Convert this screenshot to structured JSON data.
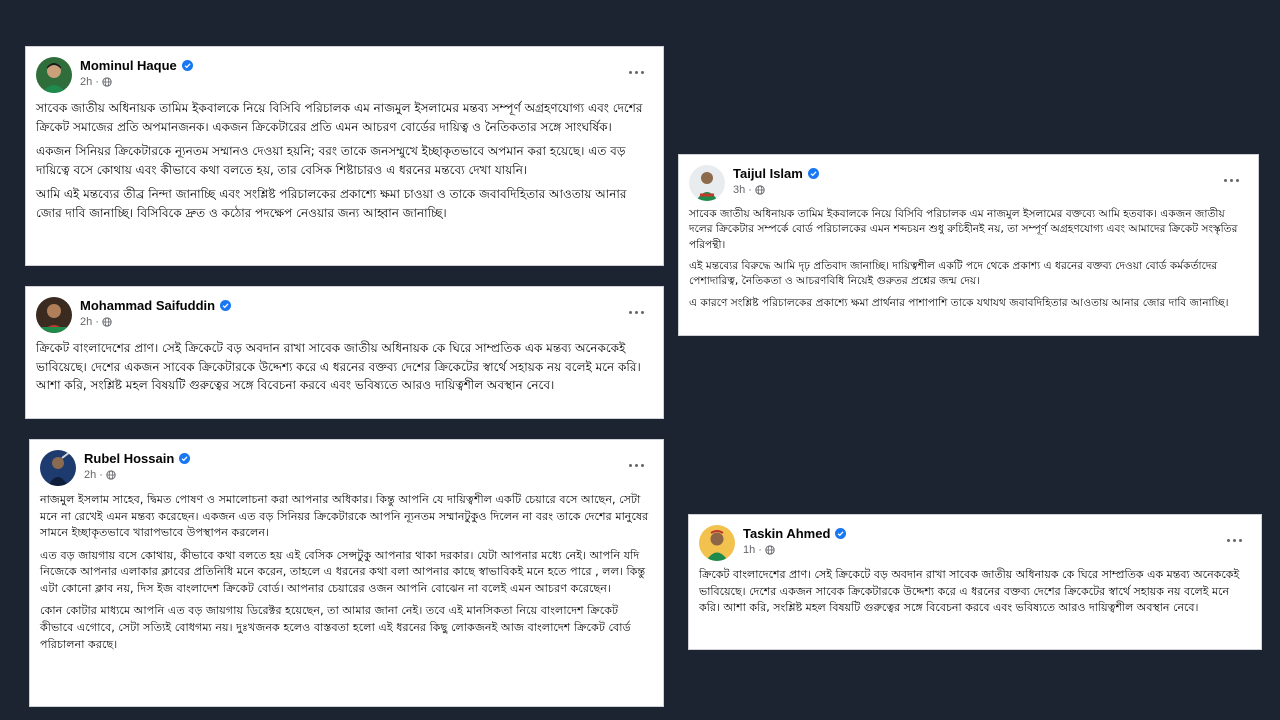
{
  "colors": {
    "background": "#1b2430",
    "verified": "#1877f2",
    "meta": "#65676b"
  },
  "posts": {
    "mominul": {
      "name": "Mominul Haque",
      "time": "2h",
      "paragraphs": [
        "সাবেক জাতীয় অধিনায়ক তামিম ইকবালকে নিয়ে বিসিবি পরিচালক এম নাজমুল ইসলামের মন্তব্য সম্পূর্ণ অগ্রহণযোগ্য এবং দেশের ক্রিকেট সমাজের প্রতি অপমানজনক। একজন ক্রিকেটারের প্রতি এমন আচরণ বোর্ডের দায়িত্ব ও নৈতিকতার সঙ্গে সাংঘর্ষিক।",
        "একজন সিনিয়র ক্রিকেটারকে ন্যূনতম সম্মানও দেওয়া হয়নি; বরং তাকে জনসম্মুখে ইচ্ছাকৃতভাবে অপমান করা হয়েছে। এত বড় দায়িত্বে বসে কোথায় এবং কীভাবে কথা বলতে হয়, তার বেসিক শিষ্টাচারও এ ধরনের মন্তব্যে দেখা যায়নি।",
        "আমি এই মন্তব্যের তীব্র নিন্দা জানাচ্ছি এবং সংশ্লিষ্ট পরিচালকের প্রকাশ্যে ক্ষমা চাওয়া ও তাকে জবাবদিহিতার আওতায় আনার জোর দাবি জানাচ্ছি। বিসিবিকে দ্রুত ও কঠোর পদক্ষেপ নেওয়ার জন্য আহ্বান জানাচ্ছি।"
      ]
    },
    "saifuddin": {
      "name": "Mohammad Saifuddin",
      "time": "2h",
      "paragraphs": [
        "ক্রিকেট বাংলাদেশের প্রাণ। সেই ক্রিকেটে বড় অবদান রাখা সাবেক জাতীয় অধিনায়ক কে ঘিরে সাম্প্রতিক এক মন্তব্য অনেককেই ভাবিয়েছে। দেশের একজন সাবেক ক্রিকেটারকে উদ্দেশ্য করে এ ধরনের বক্তব্য দেশের ক্রিকেটের স্বার্থে সহায়ক নয় বলেই মনে করি। আশা করি, সংশ্লিষ্ট মহল বিষয়টি গুরুত্বের সঙ্গে বিবেচনা করবে এবং ভবিষ্যতে আরও দায়িত্বশীল অবস্থান নেবে।"
      ]
    },
    "rubel": {
      "name": "Rubel Hossain",
      "time": "2h",
      "paragraphs": [
        "নাজমুল ইসলাম সাহেব, দ্বিমত পোষণ ও সমালোচনা করা আপনার অধিকার। কিন্তু আপনি যে দায়িত্বশীল একটি চেয়ারে বসে আছেন, সেটা মনে না রেখেই এমন মন্তব্য করেছেন। একজন এত বড় সিনিয়র ক্রিকেটারকে  আপনি ন্যূনতম সম্মানটুকুও দিলেন না বরং তাকে দেশের মানুষের সামনে ইচ্ছাকৃতভাবে খারাপভাবে উপস্থাপন করলেন।",
        "এত বড় জায়গায় বসে কোথায়, কীভাবে কথা বলতে হয় এই বেসিক সেন্সটুকু আপনার থাকা দরকার। যেটা আপনার  মধ্যে নেই। আপনি যদি নিজেকে আপনার এলাকার ক্লাবের প্রতিনিধি মনে করেন,  তাহলে এ ধরনের কথা বলা আপনার কাছে স্বাভাবিকই মনে হতে পারে , লল। কিন্তু এটা কোনো ক্লাব নয়, দিস ইজ বাংলাদেশ ক্রিকেট বোর্ড। আপনার চেয়ারের ওজন আপনি বোঝেন না বলেই এমন আচরণ করেছেন।",
        "কোন কোটার মাধ্যমে আপনি এত বড় জায়গায় ডিরেক্টর হয়েছেন, তা আমার জানা নেই। তবে এই মানসিকতা নিয়ে বাংলাদেশ ক্রিকেট কীভাবে এগোবে, সেটা সত্যিই বোধগম্য নয়। দুঃখজনক হলেও বাস্তবতা হলো এই ধরনের  কিছু লোকজনই আজ বাংলাদেশ ক্রিকেট বোর্ড পরিচালনা করছে।"
      ]
    },
    "taijul": {
      "name": "Taijul Islam",
      "time": "3h",
      "paragraphs": [
        "সাবেক জাতীয় অধিনায়ক তামিম ইকবালকে নিয়ে বিসিবি পরিচালক এম নাজমুল ইসলামের বক্তব্যে আমি হতবাক। একজন জাতীয় দলের ক্রিকেটার সম্পর্কে বোর্ড পরিচালকের এমন শব্দচয়ন শুধু রুচিহীনই নয়, তা সম্পূর্ণ অগ্রহণযোগ্য এবং আমাদের ক্রিকেট সংস্কৃতির পরিপন্থী।",
        "এই মন্তব্যের বিরুদ্ধে আমি দৃঢ় প্রতিবাদ জানাচ্ছি। দায়িত্বশীল একটি পদে থেকে প্রকাশ্য এ ধরনের বক্তব্য দেওয়া বোর্ড কর্মকর্তাদের পেশাদারিত্ব, নৈতিকতা ও আচরণবিধি নিয়েই গুরুতর প্রশ্নের জন্ম দেয়।",
        "এ কারণে সংশ্লিষ্ট পরিচালকের প্রকাশ্যে ক্ষমা প্রার্থনার পাশাপাশি তাকে যথাযথ জবাবদিহিতার আওতায় আনার জোর দাবি জানাচ্ছি।"
      ]
    },
    "taskin": {
      "name": "Taskin Ahmed",
      "time": "1h",
      "paragraphs": [
        "ক্রিকেট বাংলাদেশের প্রাণ। সেই ক্রিকেটে বড় অবদান রাখা সাবেক জাতীয় অধিনায়ক কে ঘিরে সাম্প্রতিক এক মন্তব্য অনেককেই ভাবিয়েছে। দেশের একজন সাবেক ক্রিকেটারকে উদ্দেশ্য করে এ ধরনের বক্তব্য দেশের ক্রিকেটের স্বার্থে সহায়ক নয় বলেই মনে করি। আশা করি, সংশ্লিষ্ট মহল বিষয়টি গুরুত্বের সঙ্গে বিবেচনা করবে এবং ভবিষ্যতে আরও দায়িত্বশীল অবস্থান নেবে।"
      ]
    }
  }
}
